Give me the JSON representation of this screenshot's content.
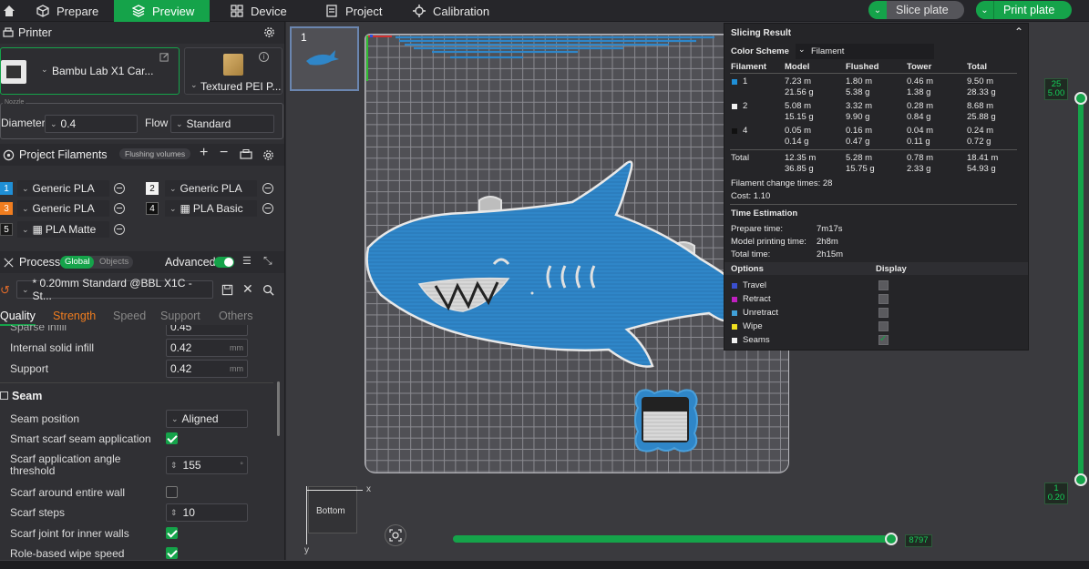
{
  "topbar": {
    "tabs": [
      {
        "label": "Prepare",
        "icon": "cube-icon"
      },
      {
        "label": "Preview",
        "icon": "layers-icon"
      },
      {
        "label": "Device",
        "icon": "device-icon"
      },
      {
        "label": "Project",
        "icon": "project-icon"
      },
      {
        "label": "Calibration",
        "icon": "calibration-icon"
      }
    ],
    "slice_label": "Slice plate",
    "print_label": "Print plate",
    "accent": "#15a34a"
  },
  "printer": {
    "section_title": "Printer",
    "printer_name": "Bambu Lab X1 Car...",
    "plate_type": "Textured PEI P...",
    "nozzle_caption": "Nozzle",
    "diameter_label": "Diameter",
    "diameter_value": "0.4",
    "flow_label": "Flow",
    "flow_value": "Standard"
  },
  "filaments": {
    "section_title": "Project Filaments",
    "flushing_label": "Flushing volumes",
    "items": [
      {
        "num": "1",
        "name": "Generic PLA",
        "color": "#1f8fd6"
      },
      {
        "num": "2",
        "name": "Generic PLA",
        "color": "#f2f2f2"
      },
      {
        "num": "3",
        "name": "Generic PLA",
        "color": "#f07d1f"
      },
      {
        "num": "4",
        "name": "PLA Basic",
        "color": "#111111"
      },
      {
        "num": "5",
        "name": "PLA Matte",
        "color": "#1a1a1a"
      }
    ]
  },
  "process": {
    "section_title": "Process",
    "global_label": "Global",
    "objects_label": "Objects",
    "advanced_label": "Advanced",
    "preset": "* 0.20mm Standard @BBL X1C - St...",
    "tabs": [
      "Quality",
      "Strength",
      "Speed",
      "Support",
      "Others"
    ],
    "clipped_row": "Sparse infill",
    "clipped_value": "0.45",
    "internal_solid_infill_label": "Internal solid infill",
    "internal_solid_infill_value": "0.42",
    "support_label": "Support",
    "support_value": "0.42",
    "unit_mm": "mm",
    "seam_title": "Seam",
    "seam_position_label": "Seam position",
    "seam_position_value": "Aligned",
    "smart_scarf_label": "Smart scarf seam application",
    "scarf_angle_label": "Scarf application angle threshold",
    "scarf_angle_value": "155",
    "unit_deg": "°",
    "scarf_entire_wall_label": "Scarf around entire wall",
    "scarf_steps_label": "Scarf steps",
    "scarf_steps_value": "10",
    "scarf_inner_label": "Scarf joint for inner walls",
    "role_wipe_label": "Role-based wipe speed"
  },
  "viewport": {
    "plate_thumb_number": "1",
    "view_cube_label": "Bottom",
    "axis_x": "x",
    "axis_y": "y",
    "top_layer": "25",
    "top_height": "5.00",
    "bottom_layer": "1",
    "bottom_height": "0.20",
    "move_count": "8797"
  },
  "slicing": {
    "title": "Slicing Result",
    "color_scheme_label": "Color Scheme",
    "color_scheme_value": "Filament",
    "headers": [
      "Filament",
      "Model",
      "Flushed",
      "Tower",
      "Total"
    ],
    "rows": [
      {
        "id": "1",
        "color": "#1f8fd6",
        "model": [
          "7.23 m",
          "21.56 g"
        ],
        "flushed": [
          "1.80 m",
          "5.38 g"
        ],
        "tower": [
          "0.46 m",
          "1.38 g"
        ],
        "total": [
          "9.50 m",
          "28.33 g"
        ]
      },
      {
        "id": "2",
        "color": "#f2f2f2",
        "model": [
          "5.08 m",
          "15.15 g"
        ],
        "flushed": [
          "3.32 m",
          "9.90 g"
        ],
        "tower": [
          "0.28 m",
          "0.84 g"
        ],
        "total": [
          "8.68 m",
          "25.88 g"
        ]
      },
      {
        "id": "4",
        "color": "#111111",
        "model": [
          "0.05 m",
          "0.14 g"
        ],
        "flushed": [
          "0.16 m",
          "0.47 g"
        ],
        "tower": [
          "0.04 m",
          "0.11 g"
        ],
        "total": [
          "0.24 m",
          "0.72 g"
        ]
      }
    ],
    "total_row": {
      "label": "Total",
      "model": [
        "12.35 m",
        "36.85 g"
      ],
      "flushed": [
        "5.28 m",
        "15.75 g"
      ],
      "tower": [
        "0.78 m",
        "2.33 g"
      ],
      "total": [
        "18.41 m",
        "54.93 g"
      ]
    },
    "change_times": "Filament change times:  28",
    "cost": "Cost:  1.10",
    "time_title": "Time Estimation",
    "prepare_label": "Prepare time:",
    "prepare_value": "7m17s",
    "model_print_label": "Model printing time:",
    "model_print_value": "2h8m",
    "total_time_label": "Total time:",
    "total_time_value": "2h15m",
    "options_label": "Options",
    "display_label": "Display",
    "options": [
      {
        "label": "Travel",
        "color": "#3a4fd0",
        "checked": false
      },
      {
        "label": "Retract",
        "color": "#c020c0",
        "checked": false
      },
      {
        "label": "Unretract",
        "color": "#40a0d8",
        "checked": false
      },
      {
        "label": "Wipe",
        "color": "#f0e020",
        "checked": false
      },
      {
        "label": "Seams",
        "color": "#f0f0f0",
        "checked": true
      }
    ]
  }
}
